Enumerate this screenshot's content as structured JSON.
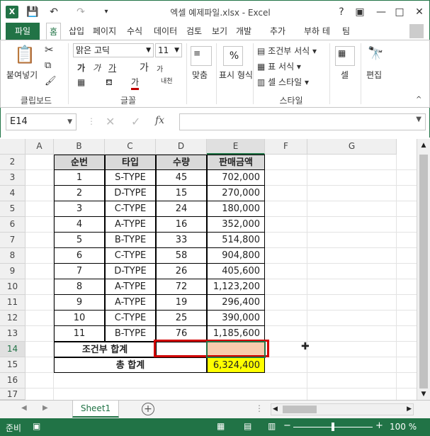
{
  "titlebar": {
    "title": "엑셀 예제파일.xlsx - Excel",
    "logo": "X",
    "help": "?",
    "minimize": "—",
    "restore": "□",
    "close": "✕"
  },
  "tabs": {
    "file": "파일",
    "items": [
      "홈",
      "삽입",
      "페이지",
      "수식",
      "데이터",
      "검토",
      "보기",
      "개발",
      "추가",
      "부하 테",
      "팀"
    ]
  },
  "ribbon": {
    "clipboard": {
      "paste": "붙여넣기",
      "label": "클립보드"
    },
    "font": {
      "name": "맑은 고딕",
      "size": "11",
      "label": "글꼴",
      "bold": "가",
      "italic": "가",
      "underline": "가",
      "grow": "가",
      "shrink": "가",
      "color_sample": "가",
      "phonetic": "내천"
    },
    "alignment": {
      "label": "맞춤"
    },
    "number": {
      "label": "표시 형식",
      "percent": "%"
    },
    "styles": {
      "conditional": "조건부 서식",
      "table": "표 서식",
      "cell": "셀 스타일",
      "label": "스타일"
    },
    "cells": {
      "label": "셀"
    },
    "editing": {
      "label": "편집"
    }
  },
  "formula_bar": {
    "name_box": "E14",
    "cancel": "✕",
    "enter": "✓",
    "fx": "fx",
    "value": ""
  },
  "columns": [
    "A",
    "B",
    "C",
    "D",
    "E",
    "F",
    "G"
  ],
  "rows": [
    "2",
    "3",
    "4",
    "5",
    "6",
    "7",
    "8",
    "9",
    "10",
    "11",
    "12",
    "13",
    "14",
    "15",
    "16",
    "17"
  ],
  "table": {
    "headers": [
      "순번",
      "타입",
      "수량",
      "판매금액"
    ],
    "rows": [
      [
        "1",
        "S-TYPE",
        "45",
        "702,000"
      ],
      [
        "2",
        "D-TYPE",
        "15",
        "270,000"
      ],
      [
        "3",
        "C-TYPE",
        "24",
        "180,000"
      ],
      [
        "4",
        "A-TYPE",
        "16",
        "352,000"
      ],
      [
        "5",
        "B-TYPE",
        "33",
        "514,800"
      ],
      [
        "6",
        "C-TYPE",
        "58",
        "904,800"
      ],
      [
        "7",
        "D-TYPE",
        "26",
        "405,600"
      ],
      [
        "8",
        "A-TYPE",
        "72",
        "1,123,200"
      ],
      [
        "9",
        "A-TYPE",
        "19",
        "296,400"
      ],
      [
        "10",
        "C-TYPE",
        "25",
        "390,000"
      ],
      [
        "11",
        "B-TYPE",
        "76",
        "1,185,600"
      ]
    ],
    "cond_total_label": "조건부 합계",
    "total_label": "총 합계",
    "total_value": "6,324,400"
  },
  "sheets": {
    "active": "Sheet1",
    "add": "+"
  },
  "status": {
    "mode": "준비",
    "zoom": "100 %"
  },
  "colors": {
    "excel_green": "#217346",
    "highlight_orange": "#f8cbad",
    "highlight_yellow": "#ffff00",
    "red_box": "#d00000"
  }
}
